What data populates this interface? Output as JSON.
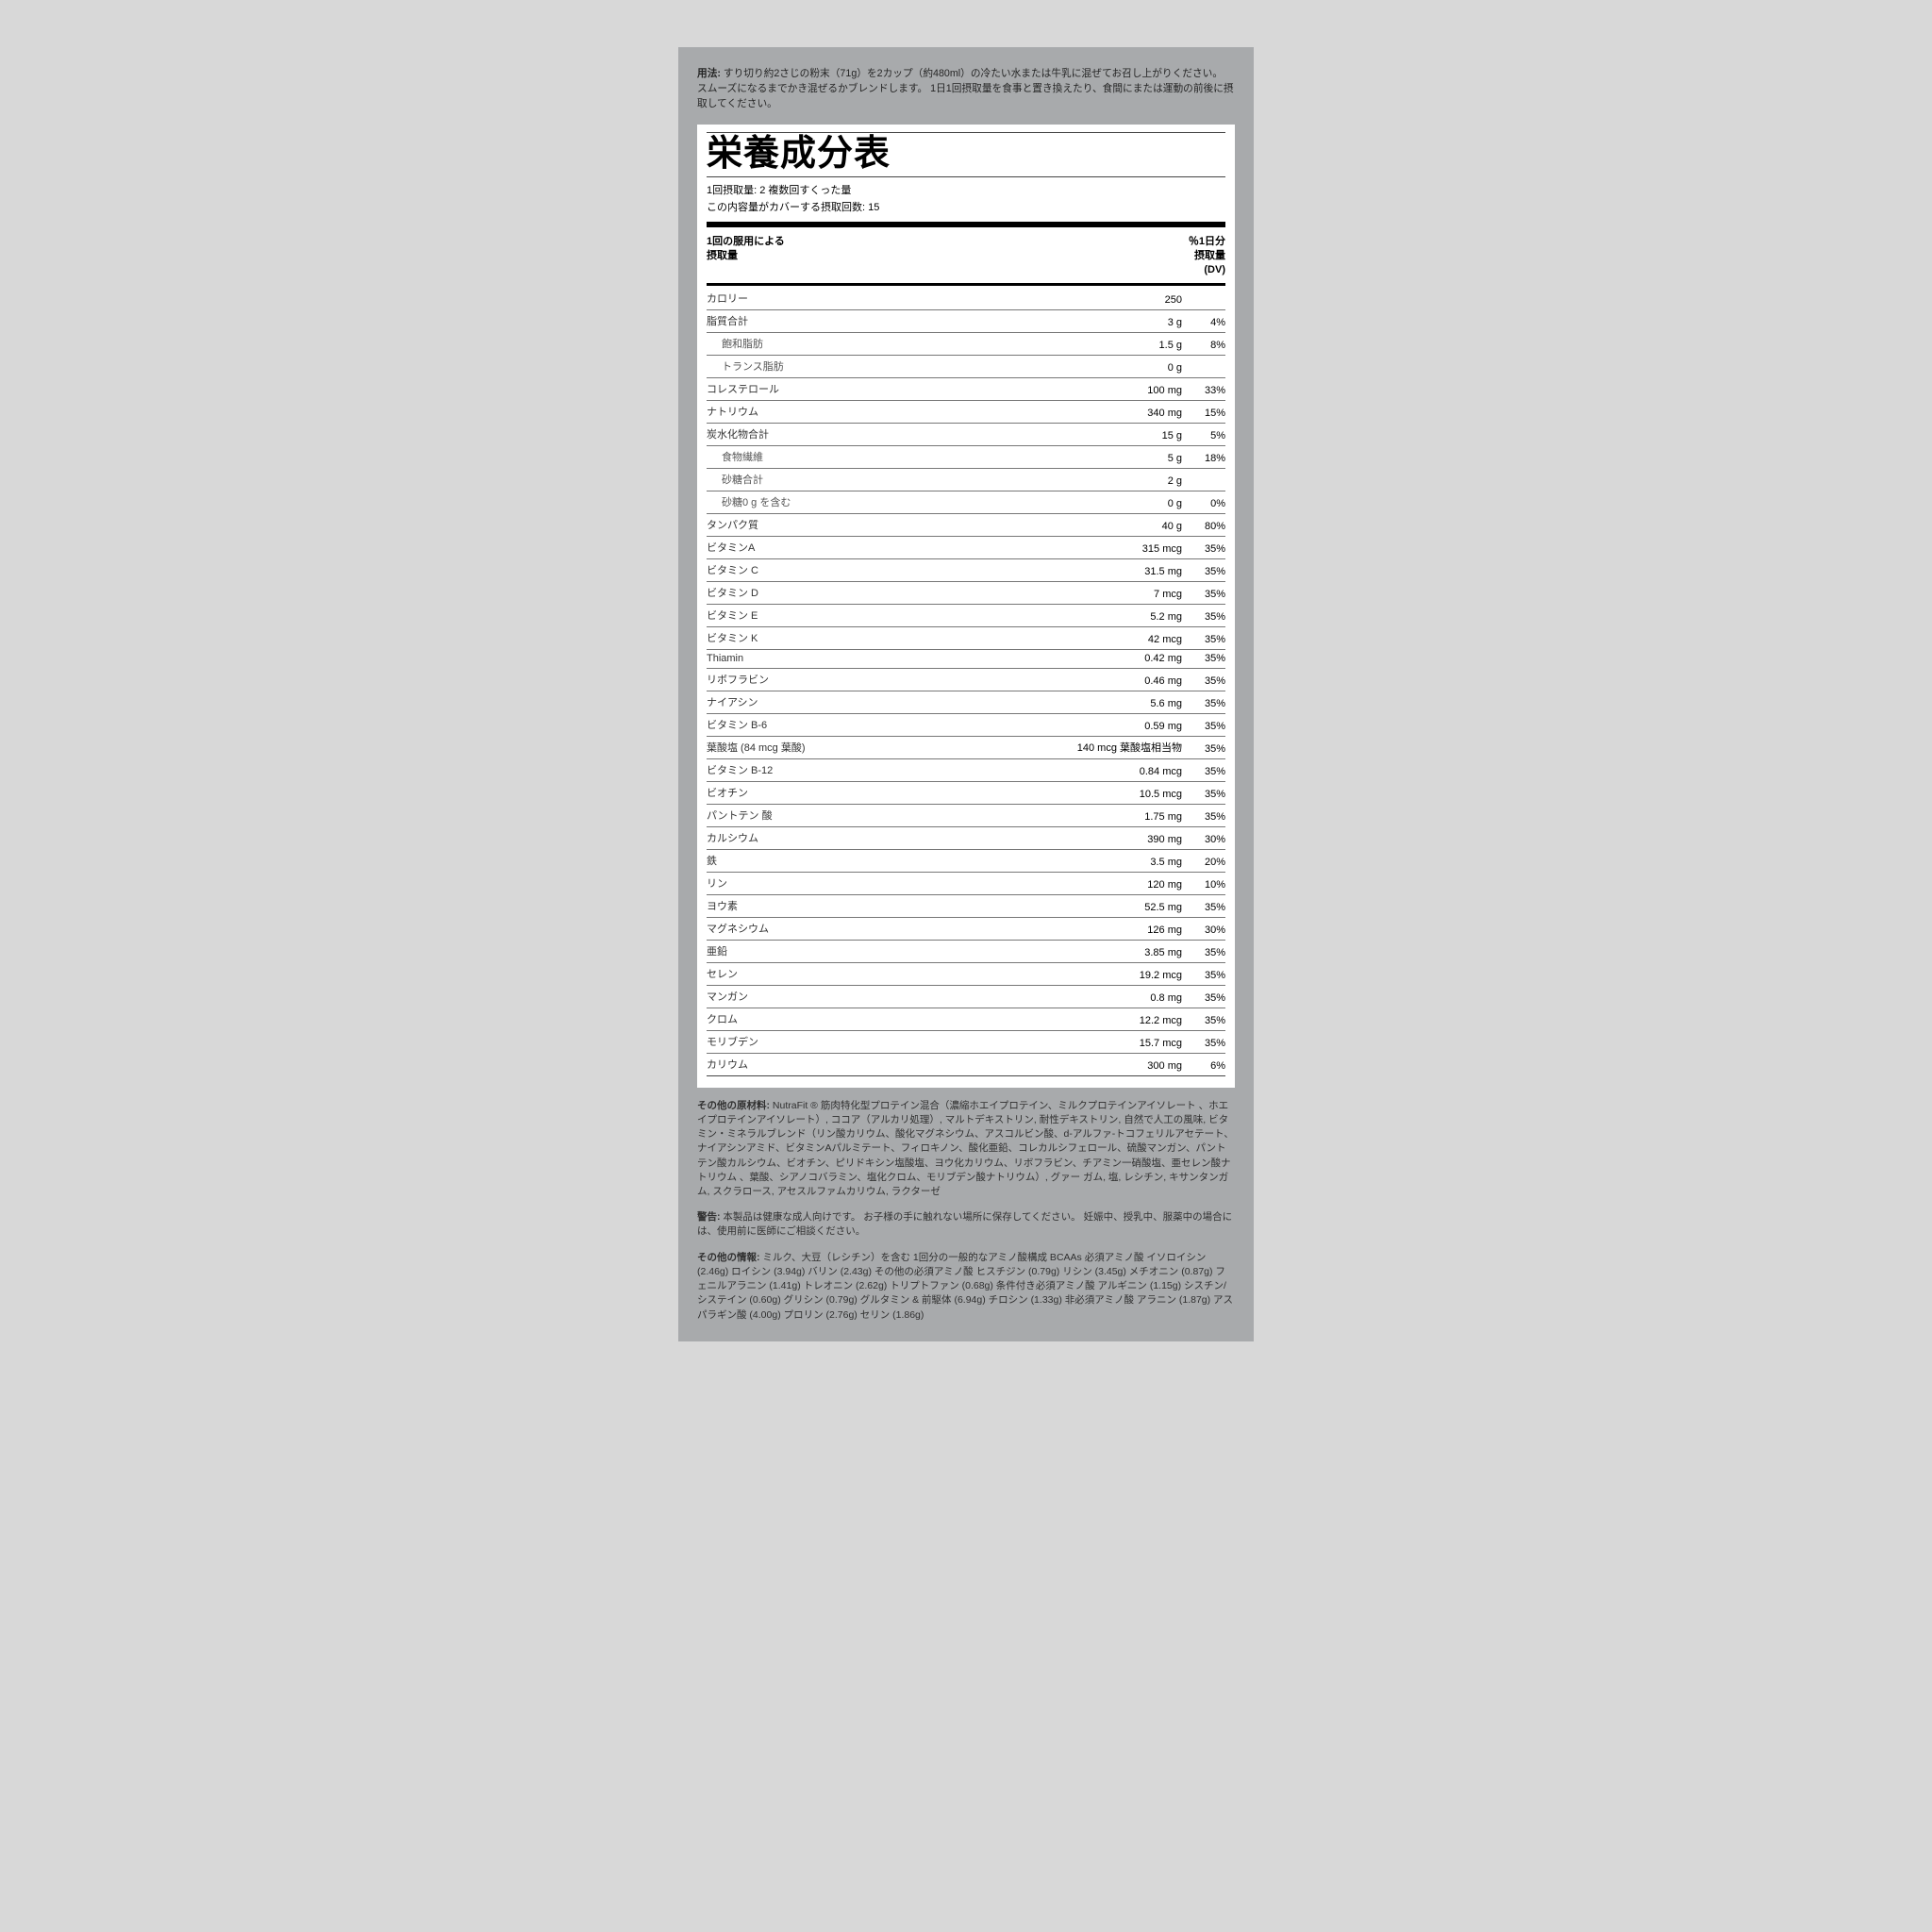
{
  "usage_label": "用法:",
  "usage_text": "すり切り約2さじの粉末（71g）を2カップ（約480ml）の冷たい水または牛乳に混ぜてお召し上がりください。 スムーズになるまでかき混ぜるかブレンドします。 1日1回摂取量を食事と置き換えたり、食間にまたは運動の前後に摂取してください。",
  "panel_title": "栄養成分表",
  "serving_size_line": "1回摂取量:   2 複数回すくった量",
  "servings_per_line": "この内容量がカバーする摂取回数:   15",
  "header_left1": "1回の服用による",
  "header_left2": "摂取量",
  "header_right1": "％1日分",
  "header_right2": "摂取量",
  "header_right3": "(DV)",
  "rows": [
    {
      "name": "カロリー",
      "amt": "250",
      "dv": "",
      "indent": false
    },
    {
      "name": "脂質合計",
      "amt": "3 g",
      "dv": "4%",
      "indent": false
    },
    {
      "name": "飽和脂肪",
      "amt": "1.5 g",
      "dv": "8%",
      "indent": true
    },
    {
      "name": "トランス脂肪",
      "amt": "0 g",
      "dv": "",
      "indent": true
    },
    {
      "name": "コレステロール",
      "amt": "100 mg",
      "dv": "33%",
      "indent": false
    },
    {
      "name": "ナトリウム",
      "amt": "340 mg",
      "dv": "15%",
      "indent": false
    },
    {
      "name": "炭水化物合計",
      "amt": "15 g",
      "dv": "5%",
      "indent": false
    },
    {
      "name": "食物繊維",
      "amt": "5 g",
      "dv": "18%",
      "indent": true
    },
    {
      "name": "砂糖合計",
      "amt": "2 g",
      "dv": "",
      "indent": true
    },
    {
      "name": "砂糖0 g を含む",
      "amt": "0 g",
      "dv": "0%",
      "indent": true
    },
    {
      "name": "タンパク質",
      "amt": "40 g",
      "dv": "80%",
      "indent": false
    },
    {
      "name": "ビタミンA",
      "amt": "315 mcg",
      "dv": "35%",
      "indent": false
    },
    {
      "name": "ビタミン C",
      "amt": "31.5 mg",
      "dv": "35%",
      "indent": false
    },
    {
      "name": "ビタミン D",
      "amt": "7 mcg",
      "dv": "35%",
      "indent": false
    },
    {
      "name": "ビタミン E",
      "amt": "5.2 mg",
      "dv": "35%",
      "indent": false
    },
    {
      "name": "ビタミン K",
      "amt": "42 mcg",
      "dv": "35%",
      "indent": false
    },
    {
      "name": "Thiamin",
      "amt": "0.42 mg",
      "dv": "35%",
      "indent": false
    },
    {
      "name": "リボフラビン",
      "amt": "0.46 mg",
      "dv": "35%",
      "indent": false
    },
    {
      "name": "ナイアシン",
      "amt": "5.6 mg",
      "dv": "35%",
      "indent": false
    },
    {
      "name": "ビタミン B-6",
      "amt": "0.59 mg",
      "dv": "35%",
      "indent": false
    },
    {
      "name": "葉酸塩 (84 mcg 葉酸)",
      "amt": "140 mcg 葉酸塩相当物",
      "dv": "35%",
      "indent": false
    },
    {
      "name": "ビタミン B-12",
      "amt": "0.84 mcg",
      "dv": "35%",
      "indent": false
    },
    {
      "name": "ビオチン",
      "amt": "10.5 mcg",
      "dv": "35%",
      "indent": false
    },
    {
      "name": "パントテン 酸",
      "amt": "1.75 mg",
      "dv": "35%",
      "indent": false
    },
    {
      "name": "カルシウム",
      "amt": "390 mg",
      "dv": "30%",
      "indent": false
    },
    {
      "name": "鉄",
      "amt": "3.5 mg",
      "dv": "20%",
      "indent": false
    },
    {
      "name": "リン",
      "amt": "120 mg",
      "dv": "10%",
      "indent": false
    },
    {
      "name": "ヨウ素",
      "amt": "52.5 mg",
      "dv": "35%",
      "indent": false
    },
    {
      "name": "マグネシウム",
      "amt": "126 mg",
      "dv": "30%",
      "indent": false
    },
    {
      "name": "亜鉛",
      "amt": "3.85 mg",
      "dv": "35%",
      "indent": false
    },
    {
      "name": "セレン",
      "amt": "19.2 mcg",
      "dv": "35%",
      "indent": false
    },
    {
      "name": "マンガン",
      "amt": "0.8 mg",
      "dv": "35%",
      "indent": false
    },
    {
      "name": "クロム",
      "amt": "12.2 mcg",
      "dv": "35%",
      "indent": false
    },
    {
      "name": "モリブデン",
      "amt": "15.7 mcg",
      "dv": "35%",
      "indent": false
    },
    {
      "name": "カリウム",
      "amt": "300 mg",
      "dv": "6%",
      "indent": false
    }
  ],
  "other_ing_label": "その他の原材料:",
  "other_ing_text": " NutraFit ® 筋肉特化型プロテイン混合（濃縮ホエイプロテイン、ミルクプロテインアイソレート 、ホエイプロテインアイソレート）, ココア（アルカリ処理）, マルトデキストリン, 耐性デキストリン, 自然で人工の風味, ビタミン・ミネラルブレンド（リン酸カリウム、酸化マグネシウム、アスコルビン酸、d-アルファ-トコフェリルアセテート、ナイアシンアミド、ビタミンAパルミテート、フィロキノン、酸化亜鉛、コレカルシフェロール、硫酸マンガン、パントテン酸カルシウム、ビオチン、ピリドキシン塩酸塩、ヨウ化カリウム、リボフラビン、チアミン一硝酸塩、亜セレン酸ナトリウム 、葉酸、シアノコバラミン、塩化クロム、モリブデン酸ナトリウム）, グァー ガム, 塩, レシチン, キサンタンガム, スクラロース, アセスルファムカリウム, ラクターゼ",
  "warning_label": "警告:",
  "warning_text": " 本製品は健康な成人向けです。 お子様の手に触れない場所に保存してください。 妊娠中、授乳中、服薬中の場合には、使用前に医師にご相談ください。",
  "other_info_label": "その他の情報:",
  "other_info_text": " ミルク、大豆（レシチン）を含む 1回分の一般的なアミノ酸構成 BCAAs 必須アミノ酸 イソロイシン (2.46g) ロイシン (3.94g) バリン (2.43g) その他の必須アミノ酸 ヒスチジン (0.79g) リシン (3.45g) メチオニン (0.87g) フェニルアラニン (1.41g) トレオニン (2.62g) トリプトファン (0.68g) 条件付き必須アミノ酸 アルギニン (1.15g) シスチン/システイン (0.60g) グリシン (0.79g) グルタミン & 前駆体 (6.94g) チロシン (1.33g) 非必須アミノ酸 アラニン (1.87g) アスパラギン酸 (4.00g) プロリン (2.76g) セリン (1.86g)"
}
